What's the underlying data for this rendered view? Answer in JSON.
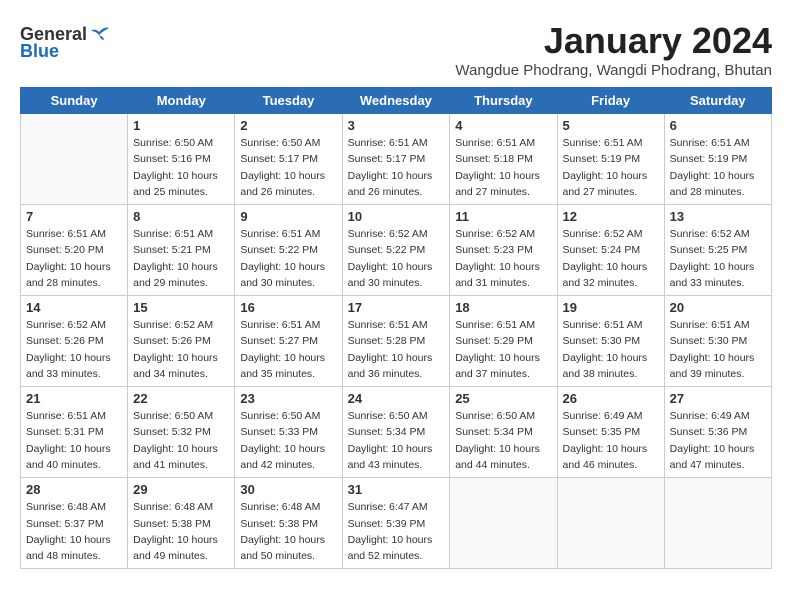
{
  "logo": {
    "general": "General",
    "blue": "Blue"
  },
  "title": "January 2024",
  "subtitle": "Wangdue Phodrang, Wangdi Phodrang, Bhutan",
  "days_of_week": [
    "Sunday",
    "Monday",
    "Tuesday",
    "Wednesday",
    "Thursday",
    "Friday",
    "Saturday"
  ],
  "weeks": [
    [
      {
        "day": "",
        "empty": true
      },
      {
        "day": "1",
        "sunrise": "Sunrise: 6:50 AM",
        "sunset": "Sunset: 5:16 PM",
        "daylight": "Daylight: 10 hours and 25 minutes."
      },
      {
        "day": "2",
        "sunrise": "Sunrise: 6:50 AM",
        "sunset": "Sunset: 5:17 PM",
        "daylight": "Daylight: 10 hours and 26 minutes."
      },
      {
        "day": "3",
        "sunrise": "Sunrise: 6:51 AM",
        "sunset": "Sunset: 5:17 PM",
        "daylight": "Daylight: 10 hours and 26 minutes."
      },
      {
        "day": "4",
        "sunrise": "Sunrise: 6:51 AM",
        "sunset": "Sunset: 5:18 PM",
        "daylight": "Daylight: 10 hours and 27 minutes."
      },
      {
        "day": "5",
        "sunrise": "Sunrise: 6:51 AM",
        "sunset": "Sunset: 5:19 PM",
        "daylight": "Daylight: 10 hours and 27 minutes."
      },
      {
        "day": "6",
        "sunrise": "Sunrise: 6:51 AM",
        "sunset": "Sunset: 5:19 PM",
        "daylight": "Daylight: 10 hours and 28 minutes."
      }
    ],
    [
      {
        "day": "7",
        "sunrise": "Sunrise: 6:51 AM",
        "sunset": "Sunset: 5:20 PM",
        "daylight": "Daylight: 10 hours and 28 minutes."
      },
      {
        "day": "8",
        "sunrise": "Sunrise: 6:51 AM",
        "sunset": "Sunset: 5:21 PM",
        "daylight": "Daylight: 10 hours and 29 minutes."
      },
      {
        "day": "9",
        "sunrise": "Sunrise: 6:51 AM",
        "sunset": "Sunset: 5:22 PM",
        "daylight": "Daylight: 10 hours and 30 minutes."
      },
      {
        "day": "10",
        "sunrise": "Sunrise: 6:52 AM",
        "sunset": "Sunset: 5:22 PM",
        "daylight": "Daylight: 10 hours and 30 minutes."
      },
      {
        "day": "11",
        "sunrise": "Sunrise: 6:52 AM",
        "sunset": "Sunset: 5:23 PM",
        "daylight": "Daylight: 10 hours and 31 minutes."
      },
      {
        "day": "12",
        "sunrise": "Sunrise: 6:52 AM",
        "sunset": "Sunset: 5:24 PM",
        "daylight": "Daylight: 10 hours and 32 minutes."
      },
      {
        "day": "13",
        "sunrise": "Sunrise: 6:52 AM",
        "sunset": "Sunset: 5:25 PM",
        "daylight": "Daylight: 10 hours and 33 minutes."
      }
    ],
    [
      {
        "day": "14",
        "sunrise": "Sunrise: 6:52 AM",
        "sunset": "Sunset: 5:26 PM",
        "daylight": "Daylight: 10 hours and 33 minutes."
      },
      {
        "day": "15",
        "sunrise": "Sunrise: 6:52 AM",
        "sunset": "Sunset: 5:26 PM",
        "daylight": "Daylight: 10 hours and 34 minutes."
      },
      {
        "day": "16",
        "sunrise": "Sunrise: 6:51 AM",
        "sunset": "Sunset: 5:27 PM",
        "daylight": "Daylight: 10 hours and 35 minutes."
      },
      {
        "day": "17",
        "sunrise": "Sunrise: 6:51 AM",
        "sunset": "Sunset: 5:28 PM",
        "daylight": "Daylight: 10 hours and 36 minutes."
      },
      {
        "day": "18",
        "sunrise": "Sunrise: 6:51 AM",
        "sunset": "Sunset: 5:29 PM",
        "daylight": "Daylight: 10 hours and 37 minutes."
      },
      {
        "day": "19",
        "sunrise": "Sunrise: 6:51 AM",
        "sunset": "Sunset: 5:30 PM",
        "daylight": "Daylight: 10 hours and 38 minutes."
      },
      {
        "day": "20",
        "sunrise": "Sunrise: 6:51 AM",
        "sunset": "Sunset: 5:30 PM",
        "daylight": "Daylight: 10 hours and 39 minutes."
      }
    ],
    [
      {
        "day": "21",
        "sunrise": "Sunrise: 6:51 AM",
        "sunset": "Sunset: 5:31 PM",
        "daylight": "Daylight: 10 hours and 40 minutes."
      },
      {
        "day": "22",
        "sunrise": "Sunrise: 6:50 AM",
        "sunset": "Sunset: 5:32 PM",
        "daylight": "Daylight: 10 hours and 41 minutes."
      },
      {
        "day": "23",
        "sunrise": "Sunrise: 6:50 AM",
        "sunset": "Sunset: 5:33 PM",
        "daylight": "Daylight: 10 hours and 42 minutes."
      },
      {
        "day": "24",
        "sunrise": "Sunrise: 6:50 AM",
        "sunset": "Sunset: 5:34 PM",
        "daylight": "Daylight: 10 hours and 43 minutes."
      },
      {
        "day": "25",
        "sunrise": "Sunrise: 6:50 AM",
        "sunset": "Sunset: 5:34 PM",
        "daylight": "Daylight: 10 hours and 44 minutes."
      },
      {
        "day": "26",
        "sunrise": "Sunrise: 6:49 AM",
        "sunset": "Sunset: 5:35 PM",
        "daylight": "Daylight: 10 hours and 46 minutes."
      },
      {
        "day": "27",
        "sunrise": "Sunrise: 6:49 AM",
        "sunset": "Sunset: 5:36 PM",
        "daylight": "Daylight: 10 hours and 47 minutes."
      }
    ],
    [
      {
        "day": "28",
        "sunrise": "Sunrise: 6:48 AM",
        "sunset": "Sunset: 5:37 PM",
        "daylight": "Daylight: 10 hours and 48 minutes."
      },
      {
        "day": "29",
        "sunrise": "Sunrise: 6:48 AM",
        "sunset": "Sunset: 5:38 PM",
        "daylight": "Daylight: 10 hours and 49 minutes."
      },
      {
        "day": "30",
        "sunrise": "Sunrise: 6:48 AM",
        "sunset": "Sunset: 5:38 PM",
        "daylight": "Daylight: 10 hours and 50 minutes."
      },
      {
        "day": "31",
        "sunrise": "Sunrise: 6:47 AM",
        "sunset": "Sunset: 5:39 PM",
        "daylight": "Daylight: 10 hours and 52 minutes."
      },
      {
        "day": "",
        "empty": true
      },
      {
        "day": "",
        "empty": true
      },
      {
        "day": "",
        "empty": true
      }
    ]
  ]
}
